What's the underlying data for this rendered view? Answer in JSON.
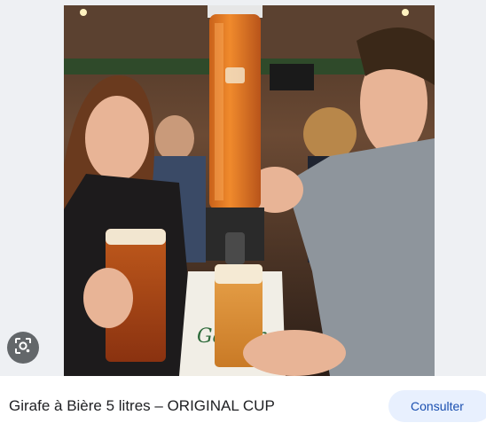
{
  "preview": {
    "image_alt": "Girafe à Bière 5 litres – ORIGINAL CUP",
    "lens_icon": "google-lens-icon",
    "tower_logo": "Garçon"
  },
  "result": {
    "title": "Girafe à Bière 5 litres – ORIGINAL CUP",
    "visit_label": "Consulter"
  },
  "colors": {
    "accent_button_bg": "#e8f0fe",
    "accent_button_text": "#1a4fb0",
    "title_text": "#202124"
  }
}
